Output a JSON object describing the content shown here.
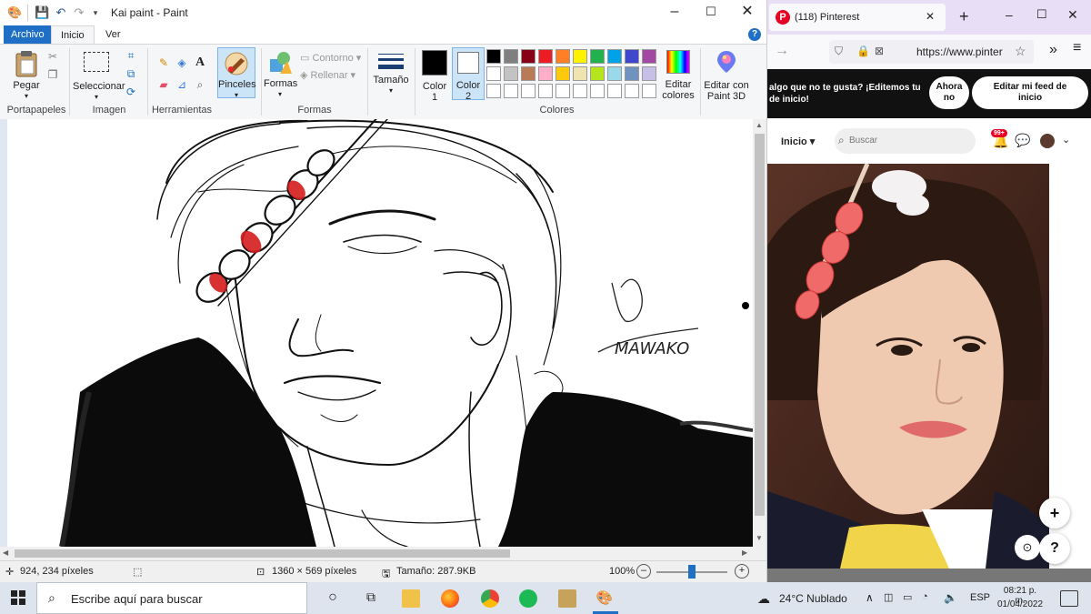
{
  "paint": {
    "window_title": "Kai paint - Paint",
    "tabs": {
      "file": "Archivo",
      "home": "Inicio",
      "view": "Ver"
    },
    "help": "?",
    "ribbon": {
      "clipboard": {
        "paste": "Pegar",
        "group": "Portapapeles"
      },
      "image": {
        "select": "Seleccionar",
        "group": "Imagen"
      },
      "tools": {
        "group": "Herramientas"
      },
      "brushes": "Pinceles",
      "shapes": {
        "label": "Formas",
        "outline": "Contorno",
        "fill": "Rellenar",
        "group": "Formas"
      },
      "size": "Tamaño",
      "color1": {
        "line1": "Color",
        "line2": "1"
      },
      "color2": {
        "line1": "Color",
        "line2": "2"
      },
      "colors_group": "Colores",
      "edit_colors": {
        "line1": "Editar",
        "line2": "colores"
      },
      "paint3d": {
        "line1": "Editar con",
        "line2": "Paint 3D"
      }
    },
    "palette_row1": [
      "#000000",
      "#7f7f7f",
      "#880015",
      "#ed1c24",
      "#ff7f27",
      "#fff200",
      "#22b14c",
      "#00a2e8",
      "#3f48cc",
      "#a349a4"
    ],
    "palette_row2": [
      "#ffffff",
      "#c3c3c3",
      "#b97a57",
      "#ffaec9",
      "#ffc90e",
      "#efe4b0",
      "#b5e61d",
      "#99d9ea",
      "#7092be",
      "#c8bfe7"
    ],
    "signature": "MAWAKO",
    "status": {
      "cursor": "924, 234 píxeles",
      "dimensions": "1360 × 569 píxeles",
      "size": "Tamaño: 287.9KB",
      "zoom": "100%",
      "zoom_level": 0.5
    }
  },
  "browser": {
    "tab_title": "(118) Pinterest",
    "url": "https://www.pinter",
    "banner_text": "algo que no te gusta? ¡Editemos tu de inicio!",
    "banner_line1": "algo que no te gusta? ¡Editemos tu",
    "banner_line2": "de inicio!",
    "now_button": {
      "line1": "Ahora",
      "line2": "no"
    },
    "edit_feed_button": {
      "line1": "Editar mi feed de",
      "line2": "inicio"
    },
    "nav_home": "Inicio",
    "search_placeholder": "Buscar",
    "notif_badge": "99+",
    "fab_plus": "+",
    "fab_help": "?"
  },
  "taskbar": {
    "search_placeholder": "Escribe aquí para buscar",
    "weather": "24°C  Nublado",
    "language": "ESP",
    "time": "08:21 p. m.",
    "date": "01/04/2022"
  }
}
